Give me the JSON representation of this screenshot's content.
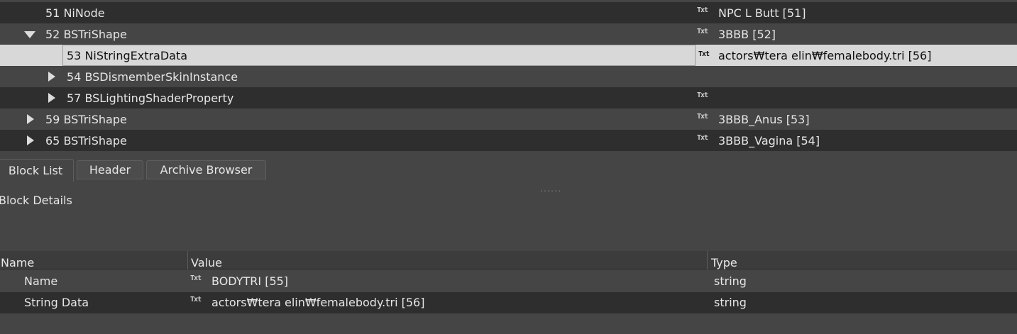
{
  "tree": {
    "rows": [
      {
        "id_label": "51 NiNode",
        "value": "NPC L Butt [51]"
      },
      {
        "id_label": "52 BSTriShape",
        "value": "3BBB [52]"
      },
      {
        "id_label": "53 NiStringExtraData",
        "value": "actors₩tera elin₩femalebody.tri [56]"
      },
      {
        "id_label": "54 BSDismemberSkinInstance",
        "value": ""
      },
      {
        "id_label": "57 BSLightingShaderProperty",
        "value": ""
      },
      {
        "id_label": "59 BSTriShape",
        "value": "3BBB_Anus [53]"
      },
      {
        "id_label": "65 BSTriShape",
        "value": "3BBB_Vagina [54]"
      }
    ],
    "icon_text": "Txt"
  },
  "tabs": {
    "block_list": "Block List",
    "header": "Header",
    "archive_browser": "Archive Browser"
  },
  "splitter": "......",
  "details": {
    "title": "Block Details",
    "columns": {
      "name": "Name",
      "value": "Value",
      "type": "Type"
    },
    "rows": [
      {
        "name": "Name",
        "value": "BODYTRI [55]",
        "type": "string"
      },
      {
        "name": "String Data",
        "value": "actors₩tera elin₩femalebody.tri [56]",
        "type": "string"
      }
    ]
  }
}
